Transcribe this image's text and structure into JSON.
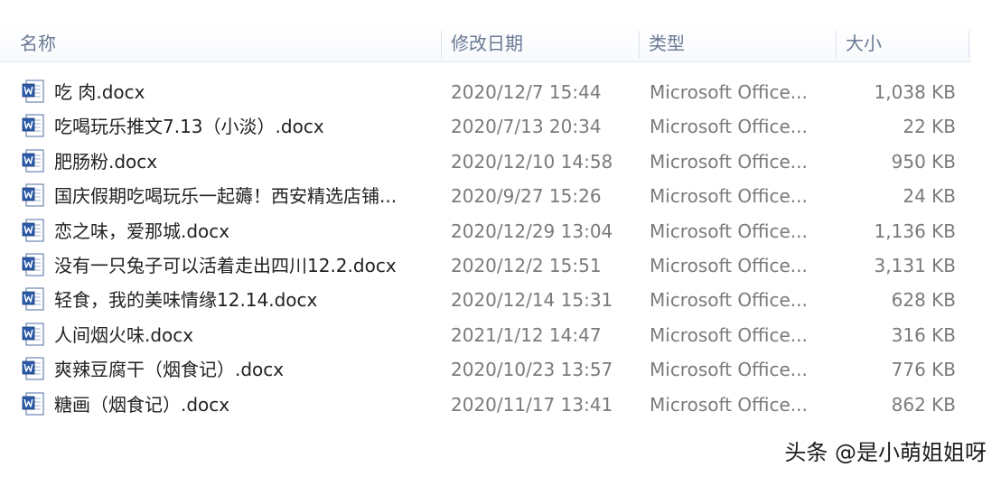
{
  "columns": {
    "name": "名称",
    "date": "修改日期",
    "type": "类型",
    "size": "大小"
  },
  "files": [
    {
      "name": "吃 肉.docx",
      "date": "2020/12/7 15:44",
      "type": "Microsoft Office...",
      "size": "1,038 KB",
      "icon": "word-document-icon"
    },
    {
      "name": "吃喝玩乐推文7.13（小淡）.docx",
      "date": "2020/7/13 20:34",
      "type": "Microsoft Office...",
      "size": "22 KB",
      "icon": "word-document-icon"
    },
    {
      "name": "肥肠粉.docx",
      "date": "2020/12/10 14:58",
      "type": "Microsoft Office...",
      "size": "950 KB",
      "icon": "word-document-icon"
    },
    {
      "name": "国庆假期吃喝玩乐一起薅！西安精选店铺...",
      "date": "2020/9/27 15:26",
      "type": "Microsoft Office...",
      "size": "24 KB",
      "icon": "word-document-icon"
    },
    {
      "name": "恋之味，爱那城.docx",
      "date": "2020/12/29 13:04",
      "type": "Microsoft Office...",
      "size": "1,136 KB",
      "icon": "word-document-icon"
    },
    {
      "name": "没有一只兔子可以活着走出四川12.2.docx",
      "date": "2020/12/2 15:51",
      "type": "Microsoft Office...",
      "size": "3,131 KB",
      "icon": "word-document-icon"
    },
    {
      "name": "轻食，我的美味情缘12.14.docx",
      "date": "2020/12/14 15:31",
      "type": "Microsoft Office...",
      "size": "628 KB",
      "icon": "word-document-icon"
    },
    {
      "name": "人间烟火味.docx",
      "date": "2021/1/12 14:47",
      "type": "Microsoft Office...",
      "size": "316 KB",
      "icon": "word-document-icon"
    },
    {
      "name": "爽辣豆腐干（烟食记）.docx",
      "date": "2020/10/23 13:57",
      "type": "Microsoft Office...",
      "size": "776 KB",
      "icon": "word-document-icon"
    },
    {
      "name": "糖画（烟食记）.docx",
      "date": "2020/11/17 13:41",
      "type": "Microsoft Office...",
      "size": "862 KB",
      "icon": "word-document-icon"
    }
  ],
  "watermark": "头条 @是小萌姐姐呀"
}
